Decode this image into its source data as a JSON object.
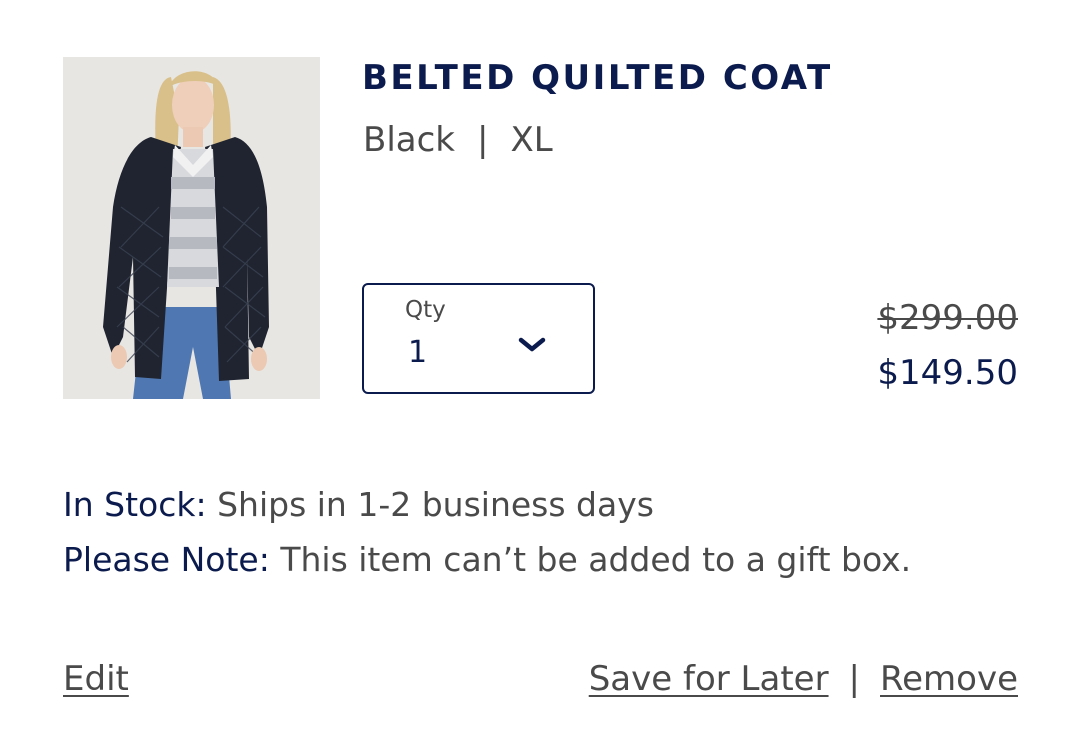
{
  "product": {
    "title": "BELTED QUILTED COAT",
    "color": "Black",
    "separator": "|",
    "size": "XL",
    "image_alt": "Model wearing black belted quilted coat"
  },
  "quantity": {
    "label": "Qty",
    "value": "1"
  },
  "pricing": {
    "original": "$299.00",
    "sale": "$149.50"
  },
  "info": {
    "stock_label": "In Stock:",
    "stock_text": "Ships in 1-2 business days",
    "note_label": "Please Note:",
    "note_text": "This item can’t be added to a gift box."
  },
  "actions": {
    "edit": "Edit",
    "save_for_later": "Save for Later",
    "divider": "|",
    "remove": "Remove"
  },
  "colors": {
    "navy": "#0b1b4d",
    "gray_text": "#4a4a4a"
  }
}
